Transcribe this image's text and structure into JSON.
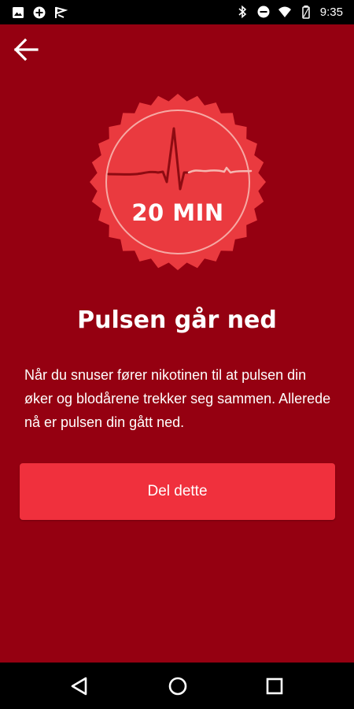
{
  "status_bar": {
    "time": "9:35",
    "left_icons": [
      "image-icon",
      "plus-circle-icon",
      "flag-icon"
    ],
    "right_icons": [
      "bluetooth-icon",
      "do-not-disturb-icon",
      "wifi-icon",
      "battery-icon"
    ]
  },
  "app_bar": {
    "back_icon": "arrow-left-icon"
  },
  "milestone": {
    "badge_label": "20 MIN",
    "badge_icon": "heartbeat-icon",
    "title": "Pulsen går ned",
    "description": "Når du snuser fører nikotinen til at pulsen din øker og blodårene trekker seg sammen. Allerede nå er pulsen din gått ned.",
    "share_label": "Del dette"
  },
  "nav_bar": {
    "buttons": [
      "back-triangle-icon",
      "home-circle-icon",
      "recents-square-icon"
    ]
  },
  "colors": {
    "background": "#950011",
    "badge": "#ea3a3f",
    "button": "#f0303d",
    "text": "#ffffff"
  }
}
